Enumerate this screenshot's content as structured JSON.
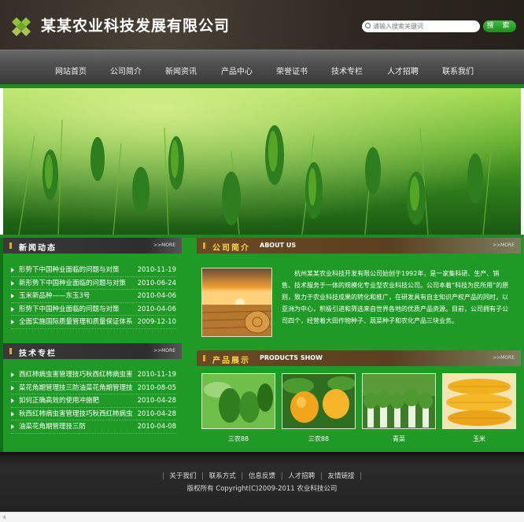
{
  "header": {
    "company_name": "某某农业科技发展有限公司",
    "search_placeholder": "请输入搜索关键词",
    "search_button": "搜 索"
  },
  "nav": {
    "items": [
      "网站首页",
      "公司简介",
      "新闻资讯",
      "产品中心",
      "荣誉证书",
      "技术专栏",
      "人才招聘",
      "联系我们"
    ]
  },
  "news": {
    "title": "新闻动态",
    "more": ">>MORE",
    "items": [
      {
        "text": "形势下中国种业面临的问题与对策",
        "date": "2010-11-19"
      },
      {
        "text": "新形势下中国种业面临的问题与对策",
        "date": "2010-06-24"
      },
      {
        "text": "玉米新品种——东玉3号",
        "date": "2010-04-06"
      },
      {
        "text": "形势下中国种业面临的问题与对策",
        "date": "2010-04-06"
      },
      {
        "text": "全面实施国际质量管理和质量保证体系",
        "date": "2009-12-10"
      }
    ]
  },
  "tech": {
    "title": "技术专栏",
    "more": ">>MORE",
    "items": [
      {
        "text": "西红柿病虫害管理技巧秋西红柿病虫害",
        "date": "2010-11-19"
      },
      {
        "text": "菜花角期管理技三防油菜花角期管理技",
        "date": "2010-08-05"
      },
      {
        "text": "如何正确高效的使用冲施肥",
        "date": "2010-04-28"
      },
      {
        "text": "秋西红柿病虫害管理技巧秋西红柿病虫",
        "date": "2010-04-28"
      },
      {
        "text": "油菜花角期管理技三防",
        "date": "2010-04-08"
      }
    ]
  },
  "about": {
    "title": "公司简介",
    "title_en": "ABOUT US",
    "more": ">>MORE",
    "text": "杭州某某农业科技开发有限公司始创于1992年，是一家集科研、生产、销售、技术服务于一体的规模化专业型农业科技公司。公司本着“科技为民所用”的原则，致力于农业科技成果的转化和推广，在研发具有自主知识产权产品的同时，以亚洲为中心，积极引进和筛选来自世界各地的优质产品资源。目前，公司拥有子公司四个，经营着大田作物种子、蔬菜种子和农化产品三块业务。"
  },
  "products": {
    "title": "产品展示",
    "title_en": "PRODUCTS SHOW",
    "more": ">>MORE",
    "items": [
      {
        "name": "三农88",
        "icon": "green-pepper-photo"
      },
      {
        "name": "三农88",
        "icon": "yellow-pepper-photo"
      },
      {
        "name": "青菜",
        "icon": "greens-photo"
      },
      {
        "name": "玉米",
        "icon": "corn-photo"
      }
    ]
  },
  "footer": {
    "links": [
      "关于我们",
      "联系方式",
      "信息反馈",
      "人才招聘",
      "友情链接"
    ],
    "copyright": "版权所有 Copyright(C)2009-2011 农业科技公司"
  },
  "colors": {
    "brand_green": "#1f9a26",
    "header_dark": "#2f2822",
    "accent_orange": "#e9a52a"
  }
}
